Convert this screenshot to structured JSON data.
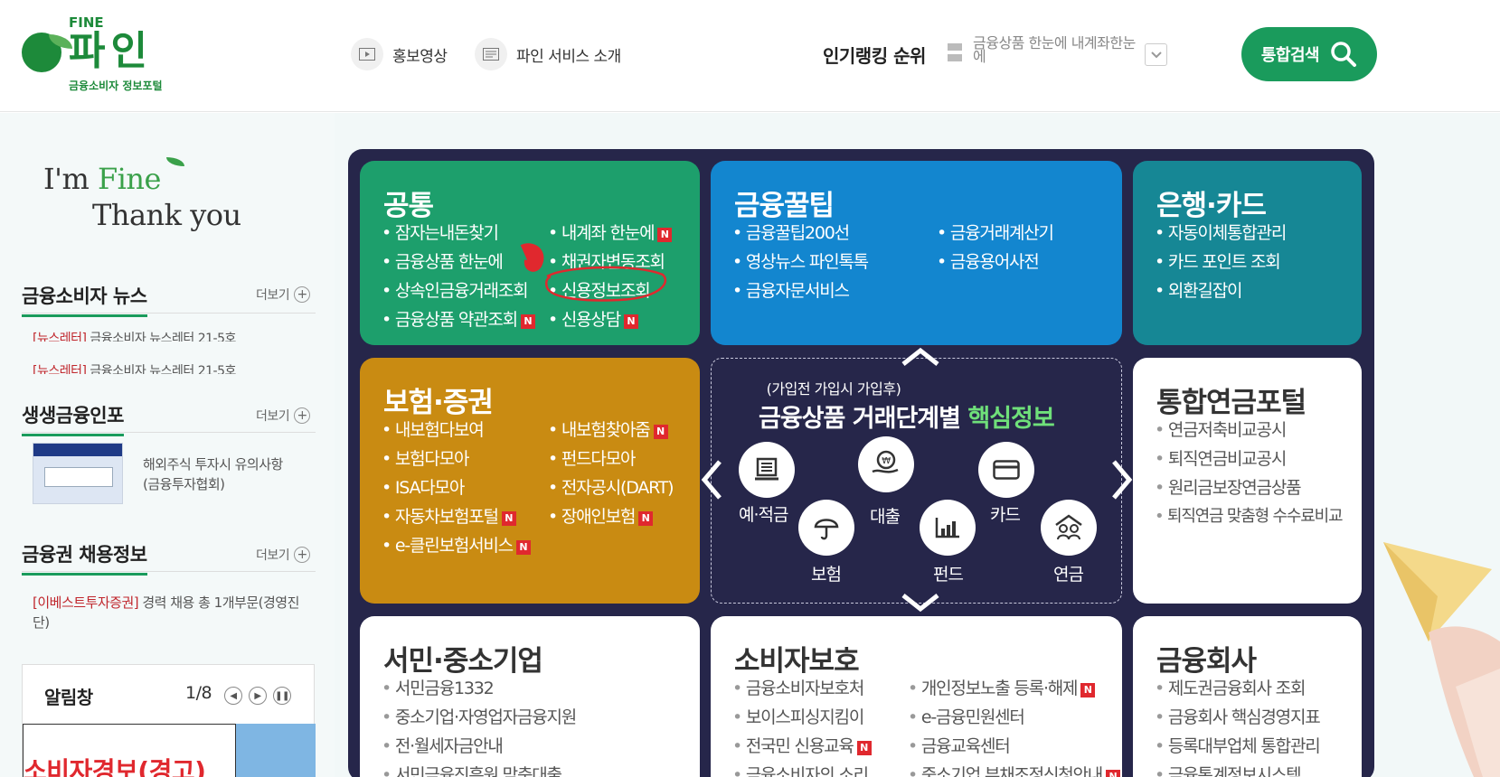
{
  "header": {
    "logo": {
      "top": "FINE",
      "name": "파인",
      "sub": "금융소비자 정보포털"
    },
    "nav": [
      {
        "label": "홍보영상",
        "icon": "play-icon"
      },
      {
        "label": "파인 서비스 소개",
        "icon": "document-icon"
      }
    ],
    "ranking": {
      "title": "인기랭킹 순위",
      "text": "금융상품 한눈에 내계좌한눈에"
    },
    "search_label": "통합검색"
  },
  "left": {
    "slogan_1": "I'm ",
    "slogan_fine": "Fine",
    "slogan_2": "Thank you",
    "more_label": "더보기",
    "news": {
      "title": "금융소비자 뉴스",
      "items": [
        {
          "tag": "[뉴스레터]",
          "text": " 금융소비자 뉴스레터 21-5호"
        },
        {
          "tag": "[뉴스레터]",
          "text": " 금융소비자 뉴스레터 21-5호"
        }
      ]
    },
    "info": {
      "title": "생생금융인포",
      "item_line1": "해외주식 투자시 유의사항",
      "item_line2": "(금융투자협회)"
    },
    "jobs": {
      "title": "금융권 채용정보",
      "tag": "[이베스트투자증권]",
      "text": " 경력 채용 총 1개부문(경영진단)"
    },
    "notice": {
      "title": "알림창",
      "page": "1/8",
      "image_text": "소비자경보(경고)"
    }
  },
  "tiles": {
    "common": {
      "title": "공통",
      "items": [
        "잠자는내돈찾기",
        "내계좌 한눈에",
        "금융상품 한눈에",
        "채권자변동조회",
        "상속인금융거래조회",
        "신용정보조회",
        "금융상품 약관조회",
        "신용상담"
      ],
      "new_badge": "N"
    },
    "tips": {
      "title": "금융꿀팁",
      "items": [
        "금융꿀팁200선",
        "금융거래계산기",
        "영상뉴스 파인톡톡",
        "금융용어사전",
        "금융자문서비스"
      ]
    },
    "bank": {
      "title": "은행·카드",
      "items": [
        "자동이체통합관리",
        "카드 포인트 조회",
        "외환길잡이"
      ]
    },
    "insurance": {
      "title": "보험·증권",
      "items": [
        "내보험다보여",
        "내보험찾아줌",
        "보험다모아",
        "펀드다모아",
        "ISA다모아",
        "전자공시(DART)",
        "자동차보험포털",
        "장애인보험",
        "e-클린보험서비스"
      ]
    },
    "center": {
      "subtitle": "(가입전 가입시 가입후)",
      "title": "금융상품 거래단계별 ",
      "title_hl": "핵심정보",
      "icons": [
        "예·적금",
        "대출",
        "카드",
        "보험",
        "펀드",
        "연금"
      ]
    },
    "pension": {
      "title": "통합연금포털",
      "items": [
        "연금저축비교공시",
        "퇴직연금비교공시",
        "원리금보장연금상품",
        "퇴직연금 맞춤형 수수료비교"
      ]
    },
    "sme": {
      "title": "서민·중소기업",
      "items": [
        "서민금융1332",
        "중소기업·자영업자금융지원",
        "전·월세자금안내",
        "서민금융진흥원 맞춤대출"
      ]
    },
    "consumer": {
      "title": "소비자보호",
      "items": [
        "금융소비자보호처",
        "개인정보노출 등록·해제",
        "보이스피싱지킴이",
        "e-금융민원센터",
        "전국민 신용교육",
        "금융교육센터",
        "금융소비자의 소리",
        "중소기업 부채조정신청안내"
      ]
    },
    "company": {
      "title": "금융회사",
      "items": [
        "제도권금융회사 조회",
        "금융회사 핵심경영지표",
        "등록대부업체 통합관리",
        "금융통계정보시스템"
      ]
    }
  },
  "colors": {
    "green": "#1a9b5c",
    "tile_green": "#1d9f6c",
    "tile_blue": "#1386cf",
    "tile_teal": "#168795",
    "tile_gold": "#c98b12",
    "board": "#26264a",
    "new_badge": "#e0282e"
  }
}
